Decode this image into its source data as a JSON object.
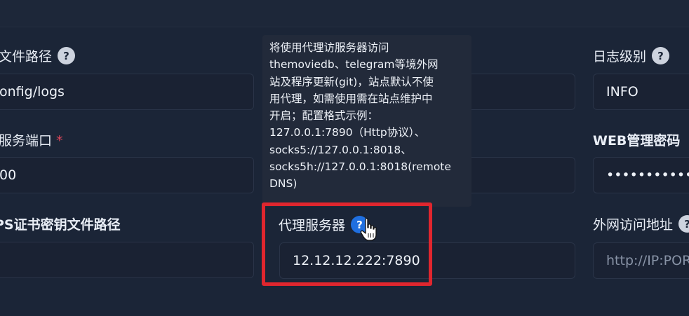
{
  "labels": {
    "log_path": "文件路径",
    "port": "服务端口",
    "ssl_key_path": "PS证书密钥文件路径",
    "proxy": "代理服务器",
    "log_level": "日志级别",
    "web_password": "WEB管理密码",
    "external_url": "外网访问地址",
    "required_mark": "*",
    "help_glyph": "?"
  },
  "fields": {
    "log_path_value": "onfig/logs",
    "port_value": "00",
    "ssl_key_value": "",
    "proxy_value": "12.12.12.222:7890",
    "log_level_value": "INFO",
    "web_password_value": "••••••••••••",
    "external_url_placeholder": "http://IP:POR"
  },
  "tooltip": {
    "lines": [
      "将使用代理访服务器访问",
      "themoviedb、telegram等境外网",
      "站及程序更新(git)，站点默认不使",
      "用代理，如需使用需在站点维护中",
      "开启；配置格式示例：",
      "127.0.0.1:7890（Http协议）、",
      "socks5://127.0.0.1:8018、",
      "socks5h://127.0.0.1:8018(remote",
      "DNS)"
    ]
  },
  "icons": {
    "help": "question-circle-icon",
    "cursor": "hand-pointer-icon"
  },
  "colors": {
    "background": "#1b2537",
    "field_bg": "#1a2233",
    "help_active": "#1f6fe0",
    "highlight_box": "#e0262e",
    "required": "#e0465a"
  }
}
